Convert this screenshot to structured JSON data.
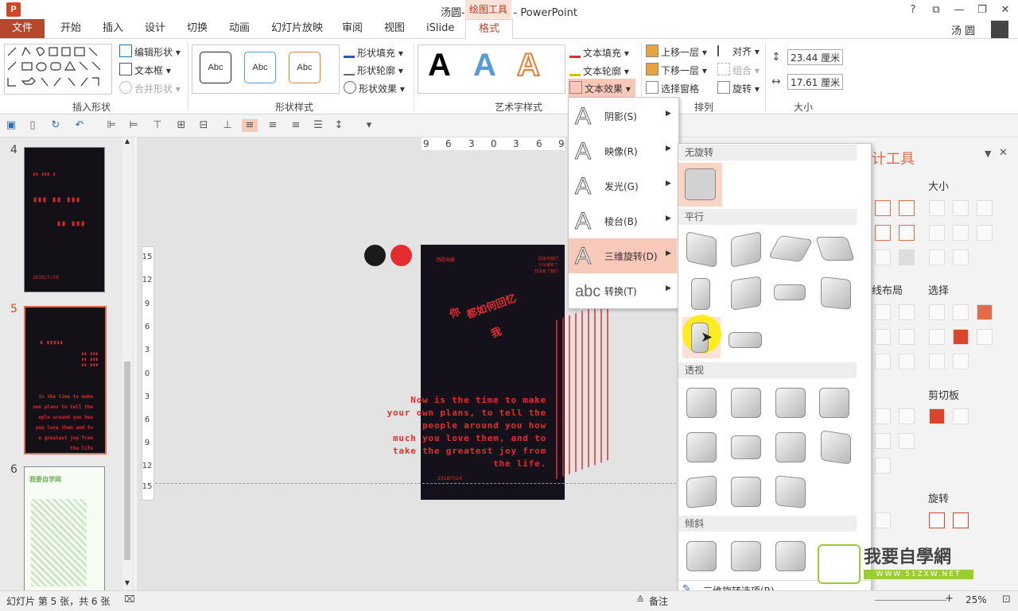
{
  "window": {
    "title": "汤圆-文字-海报 - PowerPoint",
    "context_group": "绘图工具",
    "user": "汤 圆"
  },
  "tabs": [
    "文件",
    "开始",
    "插入",
    "设计",
    "切换",
    "动画",
    "幻灯片放映",
    "审阅",
    "视图",
    "iSlide",
    "格式"
  ],
  "ribbon": {
    "insert_shapes": {
      "label": "插入形状",
      "edit_shape": "编辑形状",
      "text_box": "文本框",
      "merge_shapes": "合并形状"
    },
    "shape_styles": {
      "label": "形状样式",
      "sample": "Abc",
      "fill": "形状填充",
      "outline": "形状轮廓",
      "effects": "形状效果"
    },
    "wordart": {
      "label": "艺术字样式",
      "sample": "A",
      "text_fill": "文本填充",
      "text_outline": "文本轮廓",
      "text_effects": "文本效果"
    },
    "arrange": {
      "label": "排列",
      "bring_forward": "上移一层",
      "send_backward": "下移一层",
      "selection_pane": "选择窗格",
      "align": "对齐",
      "group": "组合",
      "rotate": "旋转"
    },
    "size": {
      "label": "大小",
      "height": "23.44 厘米",
      "width": "17.61 厘米"
    }
  },
  "thumbnails": [
    {
      "num": "4",
      "date": "2018/7/24"
    },
    {
      "num": "5",
      "text": "is the time to make\nown plans to tell the\nople around you how\nyou love them and to\ne greatest joy from\nthe life"
    },
    {
      "num": "6",
      "title": "我要自学网"
    }
  ],
  "ruler": {
    "horizontal": [
      "9",
      "6",
      "3",
      "0",
      "3",
      "6",
      "9"
    ],
    "vertical": [
      "15",
      "12",
      "9",
      "6",
      "3",
      "0",
      "3",
      "6",
      "9",
      "12",
      "15"
    ]
  },
  "slide": {
    "small_top_left": "汤圆海报",
    "small_top_right": "回来的我们\n什么都有了\n却没有了我们",
    "chinese_lines": [
      "你",
      "都如何回忆",
      "我"
    ],
    "english": [
      "Now is the time to make",
      "your own plans, to tell the",
      "people around you how",
      "much you love them, and to",
      "take the greatest joy from",
      "the life."
    ],
    "date": "2018/7/24"
  },
  "text_effects_menu": [
    {
      "label": "阴影(S)",
      "icon": "A"
    },
    {
      "label": "映像(R)",
      "icon": "A"
    },
    {
      "label": "发光(G)",
      "icon": "A"
    },
    {
      "label": "棱台(B)",
      "icon": "A"
    },
    {
      "label": "三维旋转(D)",
      "icon": "A"
    },
    {
      "label": "转换(T)",
      "icon": "abc"
    }
  ],
  "rotation_gallery": {
    "no_rotation": "无旋转",
    "parallel": "平行",
    "perspective": "透视",
    "oblique": "倾斜",
    "options": "三维旋转选项(R)..."
  },
  "right_pane": {
    "title": "计工具",
    "size": "大小",
    "layout": "线布局",
    "select": "选择",
    "clipboard": "剪切板",
    "rotate": "旋转"
  },
  "status": {
    "slide_info": "幻灯片 第 5 张，共 6 张",
    "notes": "备注",
    "zoom": "25%"
  },
  "watermark": {
    "title": "我要自學網",
    "url": "WWW.51ZXW.NET"
  },
  "colors": {
    "accent": "#b7472a",
    "poster_red": "#e52d2f",
    "poster_bg": "#14111a",
    "highlight": "#f8c9b9"
  }
}
